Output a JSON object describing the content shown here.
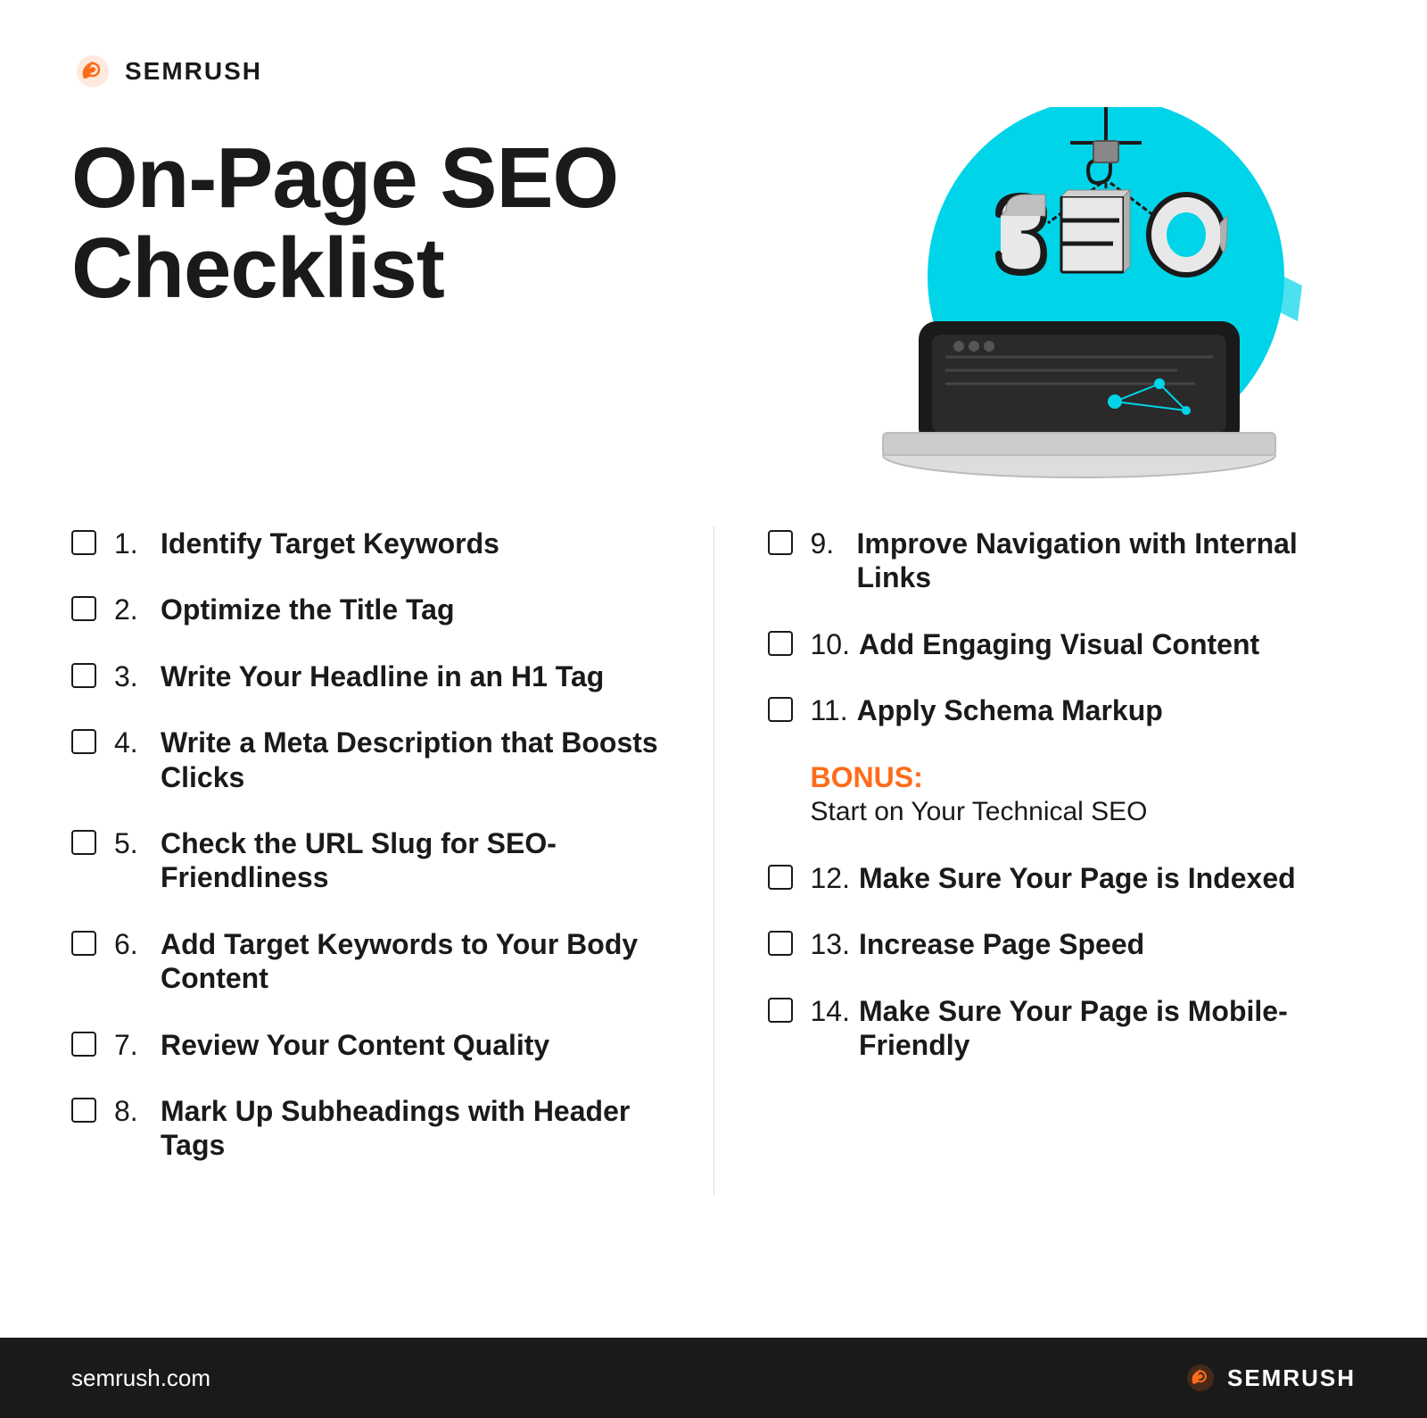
{
  "logo": {
    "text": "SEMRUSH",
    "icon": "semrush-logo-icon"
  },
  "page_title": "On-Page SEO Checklist",
  "page_title_line1": "On-Page SEO",
  "page_title_line2": "Checklist",
  "left_items": [
    {
      "number": "1.",
      "text": "Identify Target Keywords"
    },
    {
      "number": "2.",
      "text": "Optimize the Title Tag"
    },
    {
      "number": "3.",
      "text": "Write Your Headline in an H1 Tag"
    },
    {
      "number": "4.",
      "text": "Write a Meta Description that Boosts Clicks"
    },
    {
      "number": "5.",
      "text": "Check the URL Slug for SEO-Friendliness"
    },
    {
      "number": "6.",
      "text": "Add Target Keywords to Your Body Content"
    },
    {
      "number": "7.",
      "text": "Review Your Content Quality"
    },
    {
      "number": "8.",
      "text": "Mark Up Subheadings with Header Tags"
    }
  ],
  "right_items": [
    {
      "number": "9.",
      "text": "Improve Navigation with Internal Links"
    },
    {
      "number": "10.",
      "text": "Add Engaging Visual Content"
    },
    {
      "number": "11.",
      "text": "Apply Schema Markup"
    },
    {
      "number": "12.",
      "text": "Make Sure Your Page is Indexed"
    },
    {
      "number": "13.",
      "text": "Increase Page Speed"
    },
    {
      "number": "14.",
      "text": "Make Sure Your Page is Mobile-Friendly"
    }
  ],
  "bonus": {
    "label": "BONUS:",
    "sub": "Start on Your Technical SEO"
  },
  "footer": {
    "url": "semrush.com",
    "logo_text": "SEMRUSH"
  },
  "colors": {
    "orange": "#ff6b1a",
    "dark": "#1a1a1a",
    "cyan": "#00d4e8",
    "white": "#ffffff"
  }
}
